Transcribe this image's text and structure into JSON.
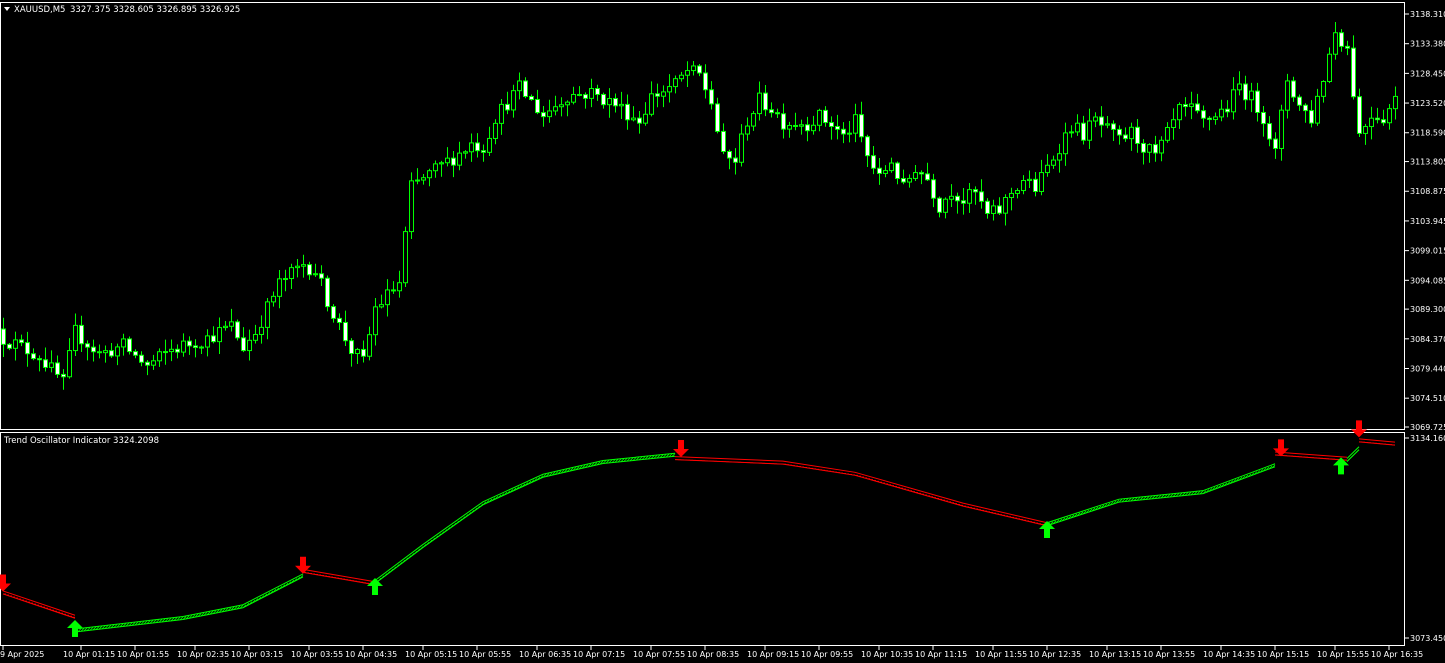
{
  "main": {
    "symbol": "XAUUSD,M5",
    "ohlc": "3327.375 3328.605 3326.895 3326.925"
  },
  "indicator": {
    "title": "Trend Oscillator Indicator 3324.2098"
  },
  "colors": {
    "background": "#000000",
    "grid_border": "#ffffff",
    "candle_bull_body": "#000000",
    "candle_bear_body": "#ffffff",
    "candle_wick": "#00ff00",
    "trend_up": "#00ff00",
    "trend_down": "#ff0000"
  },
  "chart_data": [
    {
      "type": "candlestick",
      "name": "XAUUSD,M5",
      "ylim": [
        3069.725,
        3138.31
      ],
      "y_ticks": [
        "3138.310",
        "3133.380",
        "3128.450",
        "3123.520",
        "3118.590",
        "3113.805",
        "3108.875",
        "3103.945",
        "3099.015",
        "3094.085",
        "3089.300",
        "3084.370",
        "3079.440",
        "3074.510",
        "3069.725"
      ],
      "close_path": [
        [
          0,
          3084.5
        ],
        [
          6,
          3081.5
        ],
        [
          10,
          3077.0
        ],
        [
          12,
          3085.5
        ],
        [
          16,
          3081.8
        ],
        [
          20,
          3083.2
        ],
        [
          24,
          3079.8
        ],
        [
          28,
          3082.6
        ],
        [
          34,
          3084.5
        ],
        [
          38,
          3086.5
        ],
        [
          40,
          3083.0
        ],
        [
          42,
          3085.5
        ],
        [
          46,
          3093.5
        ],
        [
          50,
          3096.8
        ],
        [
          52,
          3095.8
        ],
        [
          54,
          3090.8
        ],
        [
          56,
          3086.5
        ],
        [
          58,
          3082.5
        ],
        [
          60,
          3080.5
        ],
        [
          62,
          3089.5
        ],
        [
          66,
          3093.6
        ],
        [
          68,
          3109.5
        ],
        [
          72,
          3112.4
        ],
        [
          76,
          3115.2
        ],
        [
          78,
          3116.8
        ],
        [
          80,
          3116.2
        ],
        [
          82,
          3121.2
        ],
        [
          86,
          3126.0
        ],
        [
          90,
          3121.5
        ],
        [
          94,
          3124.8
        ],
        [
          98,
          3125.2
        ],
        [
          102,
          3123.3
        ],
        [
          106,
          3120.6
        ],
        [
          108,
          3124.6
        ],
        [
          112,
          3126.6
        ],
        [
          114,
          3128.8
        ],
        [
          116,
          3128.1
        ],
        [
          118,
          3123.7
        ],
        [
          120,
          3114.3
        ],
        [
          122,
          3114.1
        ],
        [
          124,
          3120.7
        ],
        [
          126,
          3123.9
        ],
        [
          128,
          3122.7
        ],
        [
          130,
          3120.4
        ],
        [
          134,
          3120.2
        ],
        [
          136,
          3121.2
        ],
        [
          138,
          3120.0
        ],
        [
          140,
          3117.9
        ],
        [
          142,
          3120.4
        ],
        [
          144,
          3114.7
        ],
        [
          146,
          3110.9
        ],
        [
          148,
          3114.0
        ],
        [
          150,
          3109.2
        ],
        [
          152,
          3112.9
        ],
        [
          154,
          3111.0
        ],
        [
          156,
          3106.5
        ],
        [
          158,
          3109.1
        ],
        [
          160,
          3107.4
        ],
        [
          162,
          3108.5
        ],
        [
          164,
          3104.8
        ],
        [
          166,
          3105.7
        ],
        [
          168,
          3108.7
        ],
        [
          170,
          3110.8
        ],
        [
          172,
          3109.3
        ],
        [
          174,
          3112.8
        ],
        [
          176,
          3116.4
        ],
        [
          178,
          3119.8
        ],
        [
          180,
          3118.4
        ],
        [
          182,
          3120.6
        ],
        [
          186,
          3117.2
        ],
        [
          188,
          3118.6
        ],
        [
          190,
          3116.4
        ],
        [
          192,
          3114.6
        ],
        [
          194,
          3118.2
        ],
        [
          196,
          3122.2
        ],
        [
          198,
          3122.2
        ],
        [
          200,
          3120.4
        ],
        [
          204,
          3122.8
        ],
        [
          206,
          3126.4
        ],
        [
          208,
          3124.3
        ],
        [
          210,
          3121.4
        ],
        [
          212,
          3115.2
        ],
        [
          214,
          3127.5
        ],
        [
          216,
          3123.1
        ],
        [
          218,
          3121.0
        ],
        [
          220,
          3127.8
        ],
        [
          222,
          3135.5
        ],
        [
          224,
          3132.6
        ],
        [
          226,
          3118.3
        ],
        [
          228,
          3121.8
        ],
        [
          230,
          3121.2
        ],
        [
          232,
          3124.1
        ]
      ],
      "candle_count": 233
    },
    {
      "type": "line",
      "name": "Trend Oscillator Indicator",
      "ylim": [
        3073.45,
        3134.16
      ],
      "y_ticks": [
        "3134.160",
        "3073.450"
      ],
      "segments": [
        {
          "trend": "down",
          "points": [
            [
              0,
              3087.8
            ],
            [
              12,
              3080.4
            ]
          ]
        },
        {
          "trend": "up",
          "points": [
            [
              12,
              3076.2
            ],
            [
              30,
              3080.0
            ],
            [
              40,
              3083.6
            ],
            [
              50,
              3093.0
            ]
          ]
        },
        {
          "trend": "down",
          "points": [
            [
              50,
              3094.4
            ],
            [
              62,
              3090.6
            ]
          ]
        },
        {
          "trend": "up",
          "points": [
            [
              62,
              3091.0
            ],
            [
              70,
              3102.0
            ],
            [
              80,
              3115.0
            ],
            [
              90,
              3123.4
            ],
            [
              100,
              3127.6
            ],
            [
              112,
              3129.8
            ]
          ]
        },
        {
          "trend": "down",
          "points": [
            [
              112,
              3128.8
            ],
            [
              130,
              3127.4
            ],
            [
              142,
              3124.0
            ],
            [
              160,
              3114.6
            ],
            [
              174,
              3108.6
            ]
          ]
        },
        {
          "trend": "up",
          "points": [
            [
              174,
              3108.6
            ],
            [
              186,
              3115.8
            ],
            [
              200,
              3118.4
            ],
            [
              212,
              3126.6
            ]
          ]
        },
        {
          "trend": "down",
          "points": [
            [
              212,
              3130.2
            ],
            [
              224,
              3128.6
            ]
          ]
        },
        {
          "trend": "up",
          "points": [
            [
              224,
              3128.2
            ],
            [
              226,
              3131.8
            ]
          ]
        },
        {
          "trend": "down",
          "points": [
            [
              226,
              3134.2
            ],
            [
              232,
              3133.2
            ]
          ]
        }
      ],
      "signals": [
        {
          "type": "down",
          "bar": 0,
          "value": 3090.4
        },
        {
          "type": "up",
          "bar": 12,
          "value": 3076.2
        },
        {
          "type": "down",
          "bar": 50,
          "value": 3095.8
        },
        {
          "type": "up",
          "bar": 62,
          "value": 3089.0
        },
        {
          "type": "down",
          "bar": 113,
          "value": 3131.4
        },
        {
          "type": "up",
          "bar": 174,
          "value": 3106.4
        },
        {
          "type": "down",
          "bar": 213,
          "value": 3131.6
        },
        {
          "type": "up",
          "bar": 223,
          "value": 3125.8
        },
        {
          "type": "down",
          "bar": 226,
          "value": 3137.4
        }
      ]
    }
  ],
  "x_axis": {
    "labels": [
      {
        "bar": 0,
        "text": "9 Apr 2025"
      },
      {
        "bar": 13,
        "text": "10 Apr 01:15"
      },
      {
        "bar": 22,
        "text": "10 Apr 01:55"
      },
      {
        "bar": 32,
        "text": "10 Apr 02:35"
      },
      {
        "bar": 41,
        "text": "10 Apr 03:15"
      },
      {
        "bar": 51,
        "text": "10 Apr 03:55"
      },
      {
        "bar": 60,
        "text": "10 Apr 04:35"
      },
      {
        "bar": 70,
        "text": "10 Apr 05:15"
      },
      {
        "bar": 79,
        "text": "10 Apr 05:55"
      },
      {
        "bar": 89,
        "text": "10 Apr 06:35"
      },
      {
        "bar": 98,
        "text": "10 Apr 07:15"
      },
      {
        "bar": 108,
        "text": "10 Apr 07:55"
      },
      {
        "bar": 117,
        "text": "10 Apr 08:35"
      },
      {
        "bar": 127,
        "text": "10 Apr 09:15"
      },
      {
        "bar": 136,
        "text": "10 Apr 09:55"
      },
      {
        "bar": 146,
        "text": "10 Apr 10:35"
      },
      {
        "bar": 155,
        "text": "10 Apr 11:15"
      },
      {
        "bar": 165,
        "text": "10 Apr 11:55"
      },
      {
        "bar": 174,
        "text": "10 Apr 12:35"
      },
      {
        "bar": 184,
        "text": "10 Apr 13:15"
      },
      {
        "bar": 193,
        "text": "10 Apr 13:55"
      },
      {
        "bar": 203,
        "text": "10 Apr 14:35"
      },
      {
        "bar": 212,
        "text": "10 Apr 15:15"
      },
      {
        "bar": 222,
        "text": "10 Apr 15:55"
      },
      {
        "bar": 231,
        "text": "10 Apr 16:35"
      }
    ]
  }
}
